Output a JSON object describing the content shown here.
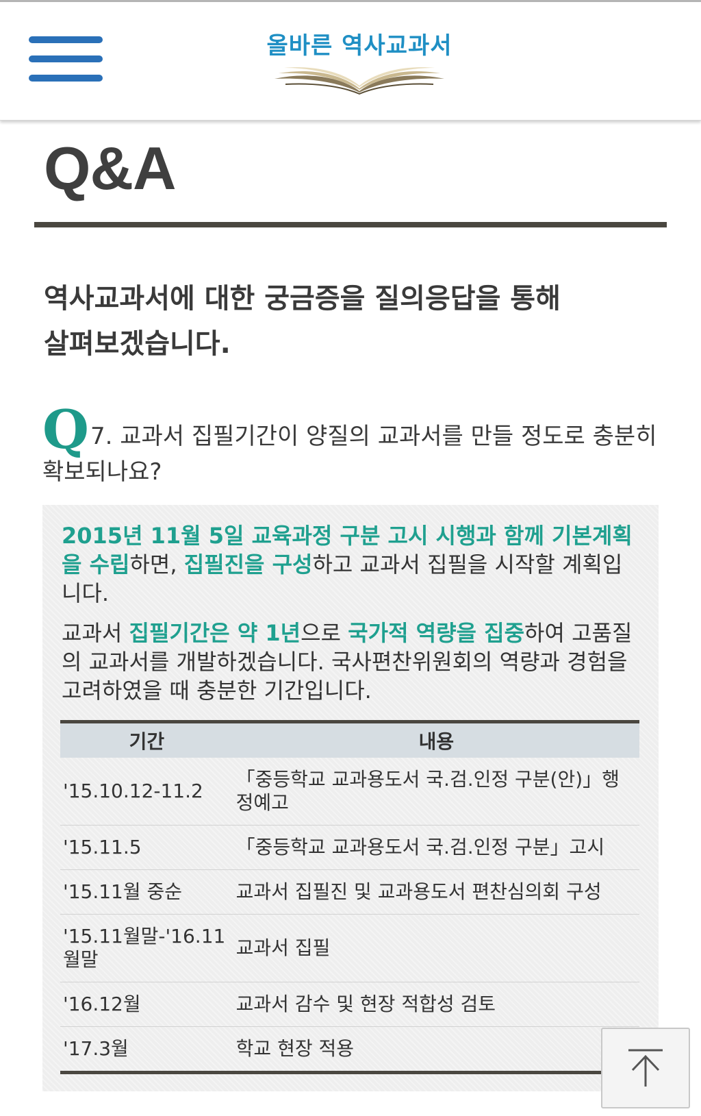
{
  "header": {
    "logo_text": "올바른 역사교과서",
    "brand_color": "#1f8fc4",
    "menu_icon": "hamburger-menu-icon"
  },
  "page": {
    "title": "Q&A",
    "intro_line1": "역사교과서에 대한 궁금증을 질의응답을 통해",
    "intro_line2": "살펴보겠습니다."
  },
  "question": {
    "mark": "Q",
    "text": "7. 교과서 집필기간이 양질의 교과서를 만들 정도로 충분히 확보되나요?",
    "accent_color": "#1e9a8a"
  },
  "answer": {
    "p1": {
      "hl1": "2015년 11월 5일 교육과정 구분 고시 시행과 함께 기본계획을 수립",
      "t1": "하면, ",
      "hl2": "집필진을 구성",
      "t2": "하고 교과서 집필을 시작할 계획입니다."
    },
    "p2": {
      "t0": "교과서 ",
      "hl1": "집필기간은 약 1년",
      "t1": "으로 ",
      "hl2": "국가적 역량을 집중",
      "t2": "하여 고품질의 교과서를 개발하겠습니다. 국사편찬위원회의 역량과 경험을 고려하였을 때 충분한 기간입니다."
    },
    "highlight_color": "#1fa08f"
  },
  "schedule": {
    "headers": {
      "period": "기간",
      "content": "내용"
    },
    "rows": [
      {
        "period": "'15.10.12-11.2",
        "content": "「중등학교 교과용도서 국.검.인정 구분(안)」행정예고"
      },
      {
        "period": "'15.11.5",
        "content": "「중등학교 교과용도서 국.검.인정 구분」고시"
      },
      {
        "period": "'15.11월 중순",
        "content": "교과서 집필진 및 교과용도서 편찬심의회 구성"
      },
      {
        "period": "'15.11월말-'16.11월말",
        "content": "교과서 집필"
      },
      {
        "period": "'16.12월",
        "content": "교과서 감수 및 현장 적합성 검토"
      },
      {
        "period": "'17.3월",
        "content": "학교 현장 적용"
      }
    ]
  },
  "scroll_top": {
    "icon": "arrow-up-to-top-icon"
  }
}
